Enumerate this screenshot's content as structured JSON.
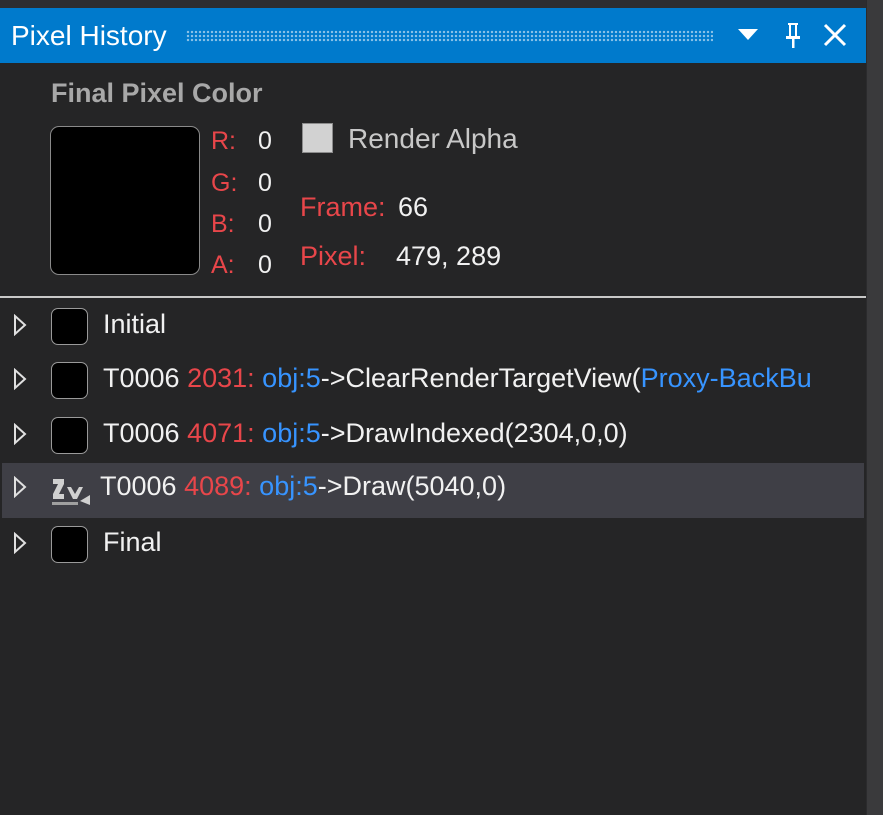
{
  "window": {
    "title": "Pixel History"
  },
  "header": {
    "section_title": "Final Pixel Color",
    "swatch_color": "#000000",
    "channels": [
      {
        "label": "R:",
        "value": "0"
      },
      {
        "label": "G:",
        "value": "0"
      },
      {
        "label": "B:",
        "value": "0"
      },
      {
        "label": "A:",
        "value": "0"
      }
    ],
    "render_alpha_label": "Render Alpha",
    "render_alpha_checked": false,
    "frame_label": "Frame:",
    "frame_value": "66",
    "pixel_label": "Pixel:",
    "pixel_value": "479, 289"
  },
  "events": [
    {
      "label": "Initial",
      "icon": "black-swatch"
    },
    {
      "thread": "T0006",
      "event_id": "2031:",
      "obj": "obj:5",
      "arrow": "->",
      "call": "ClearRenderTargetView(",
      "arg": "Proxy-BackBu",
      "icon": "black-swatch"
    },
    {
      "thread": "T0006",
      "event_id": "4071:",
      "obj": "obj:5",
      "arrow": "->",
      "call": "DrawIndexed(2304,0,0)",
      "icon": "black-swatch"
    },
    {
      "thread": "T0006",
      "event_id": "4089:",
      "obj": "obj:5",
      "arrow": "->",
      "call": "Draw(5040,0)",
      "icon": "draw-call-icon",
      "selected": true
    },
    {
      "label": "Final",
      "icon": "black-swatch"
    }
  ],
  "colors": {
    "titlebar": "#007acc",
    "background": "#252526",
    "selected_row": "#3f3f46",
    "label_red": "#e8464a",
    "link_blue": "#3794ff"
  }
}
